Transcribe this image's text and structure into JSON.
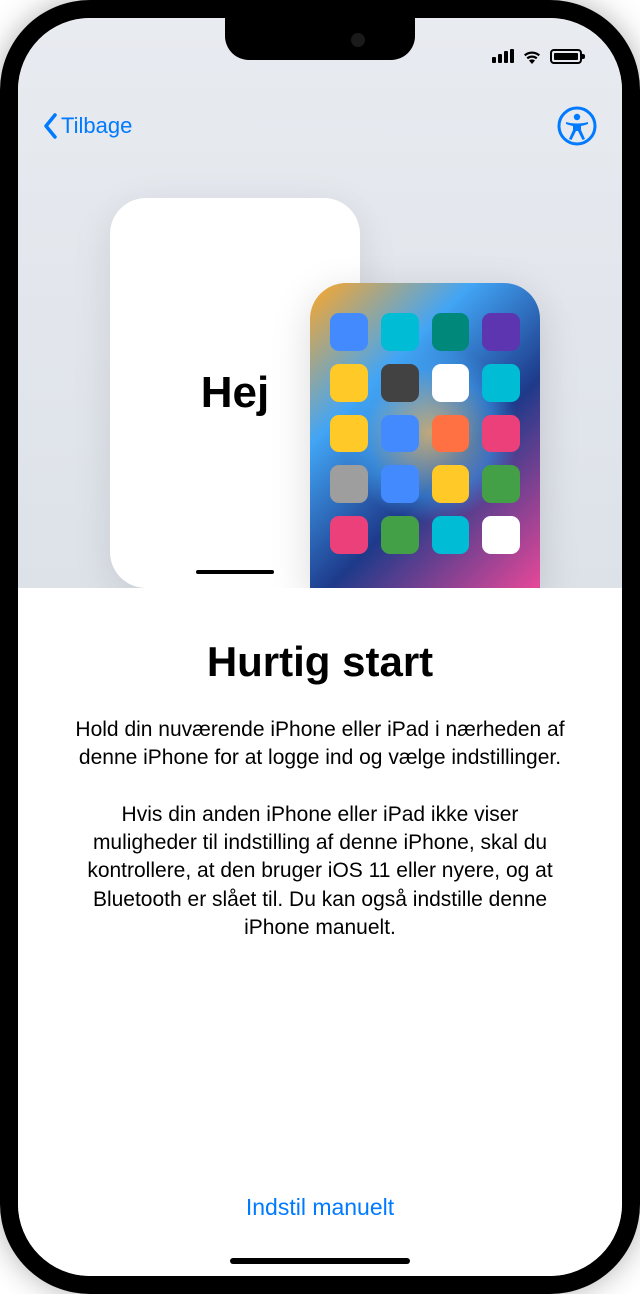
{
  "nav": {
    "back_label": "Tilbage"
  },
  "illustration": {
    "hello_text": "Hej",
    "app_colors": [
      "#448aff",
      "#00bcd4",
      "#00897b",
      "#5e35b1",
      "#ffca28",
      "#424242",
      "#ffffff",
      "#00bcd4",
      "#ffca28",
      "#448aff",
      "#ff7043",
      "#ec407a",
      "#9e9e9e",
      "#448aff",
      "#ffca28",
      "#43a047",
      "#ec407a",
      "#43a047",
      "#00bcd4",
      "#ffffff"
    ]
  },
  "content": {
    "title": "Hurtig start",
    "paragraph1": "Hold din nuværende iPhone eller iPad i nærheden af denne iPhone for at logge ind og vælge indstillinger.",
    "paragraph2": "Hvis din anden iPhone eller iPad ikke viser muligheder til indstilling af denne iPhone, skal du kontrollere, at den bruger iOS 11 eller nyere, og at Bluetooth er slået til. Du kan også indstille denne iPhone manuelt."
  },
  "footer": {
    "manual_label": "Indstil manuelt"
  }
}
